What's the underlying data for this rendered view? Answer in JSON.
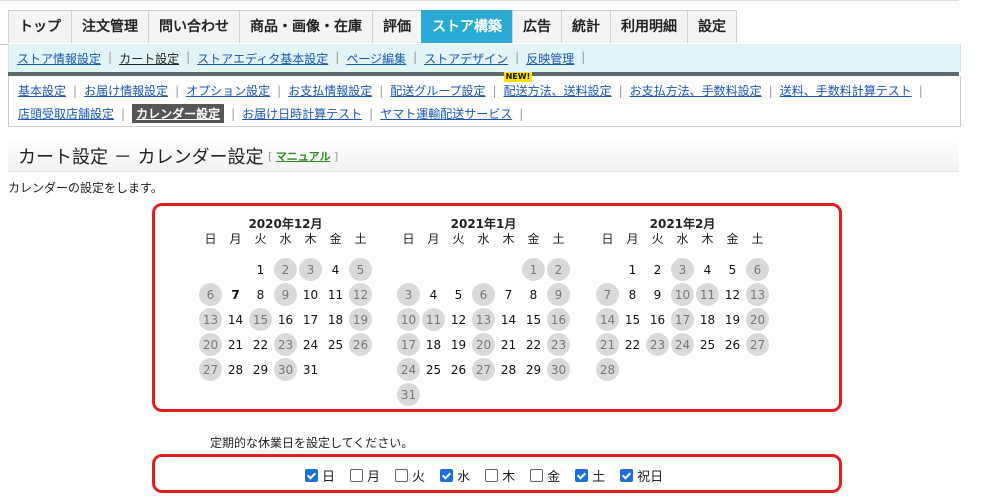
{
  "top_tabs": [
    "トップ",
    "注文管理",
    "問い合わせ",
    "商品・画像・在庫",
    "評価",
    "ストア構築",
    "広告",
    "統計",
    "利用明細",
    "設定"
  ],
  "active_tab": "ストア構築",
  "sub_nav1": [
    "ストア情報設定",
    "カート設定",
    "ストアエディタ基本設定",
    "ページ編集",
    "ストアデザイン",
    "反映管理"
  ],
  "sub_nav1_current": "カート設定",
  "sub_nav2_row1": [
    "基本設定",
    "お届け情報設定",
    "オプション設定",
    "お支払情報設定",
    "配送グループ設定",
    "配送方法、送料設定",
    "お支払方法、手数料設定",
    "送料、手数料計算テスト"
  ],
  "sub_nav2_row2": [
    "店頭受取店舗設定",
    "カレンダー設定",
    "お届け日時計算テスト",
    "ヤマト運輸配送サービス"
  ],
  "new_badge": "NEW!",
  "new_badge_target": "配送方法、送料設定",
  "sub_nav2_current": "カレンダー設定",
  "page_title": "カート設定 － カレンダー設定",
  "manual_link": "マニュアル",
  "description": "カレンダーの設定をします。",
  "weekday_labels": [
    "日",
    "月",
    "火",
    "水",
    "木",
    "金",
    "土"
  ],
  "months": [
    {
      "title": "2020年12月",
      "first_weekday": 2,
      "days": 31,
      "holidays": [
        2,
        3,
        5,
        6,
        9,
        12,
        13,
        15,
        19,
        20,
        23,
        26,
        27,
        30
      ],
      "today": 7
    },
    {
      "title": "2021年1月",
      "first_weekday": 5,
      "days": 31,
      "holidays": [
        1,
        2,
        3,
        6,
        9,
        10,
        11,
        13,
        16,
        17,
        20,
        23,
        24,
        27,
        30,
        31
      ]
    },
    {
      "title": "2021年2月",
      "first_weekday": 1,
      "days": 28,
      "holidays": [
        3,
        6,
        7,
        10,
        11,
        13,
        14,
        17,
        20,
        21,
        23,
        24,
        27,
        28
      ]
    }
  ],
  "prompt": "定期的な休業日を設定してください。",
  "checkboxes": [
    {
      "label": "日",
      "checked": true
    },
    {
      "label": "月",
      "checked": false
    },
    {
      "label": "火",
      "checked": false
    },
    {
      "label": "水",
      "checked": true
    },
    {
      "label": "木",
      "checked": false
    },
    {
      "label": "金",
      "checked": false
    },
    {
      "label": "土",
      "checked": true
    },
    {
      "label": "祝日",
      "checked": true
    }
  ],
  "colors": {
    "active_tab": "#2aa9d3",
    "highlight_border": "#e31e1e",
    "holiday_circle": "#d9d9d9",
    "checkbox_on": "#1d6fdc",
    "link": "#1a57b5"
  }
}
